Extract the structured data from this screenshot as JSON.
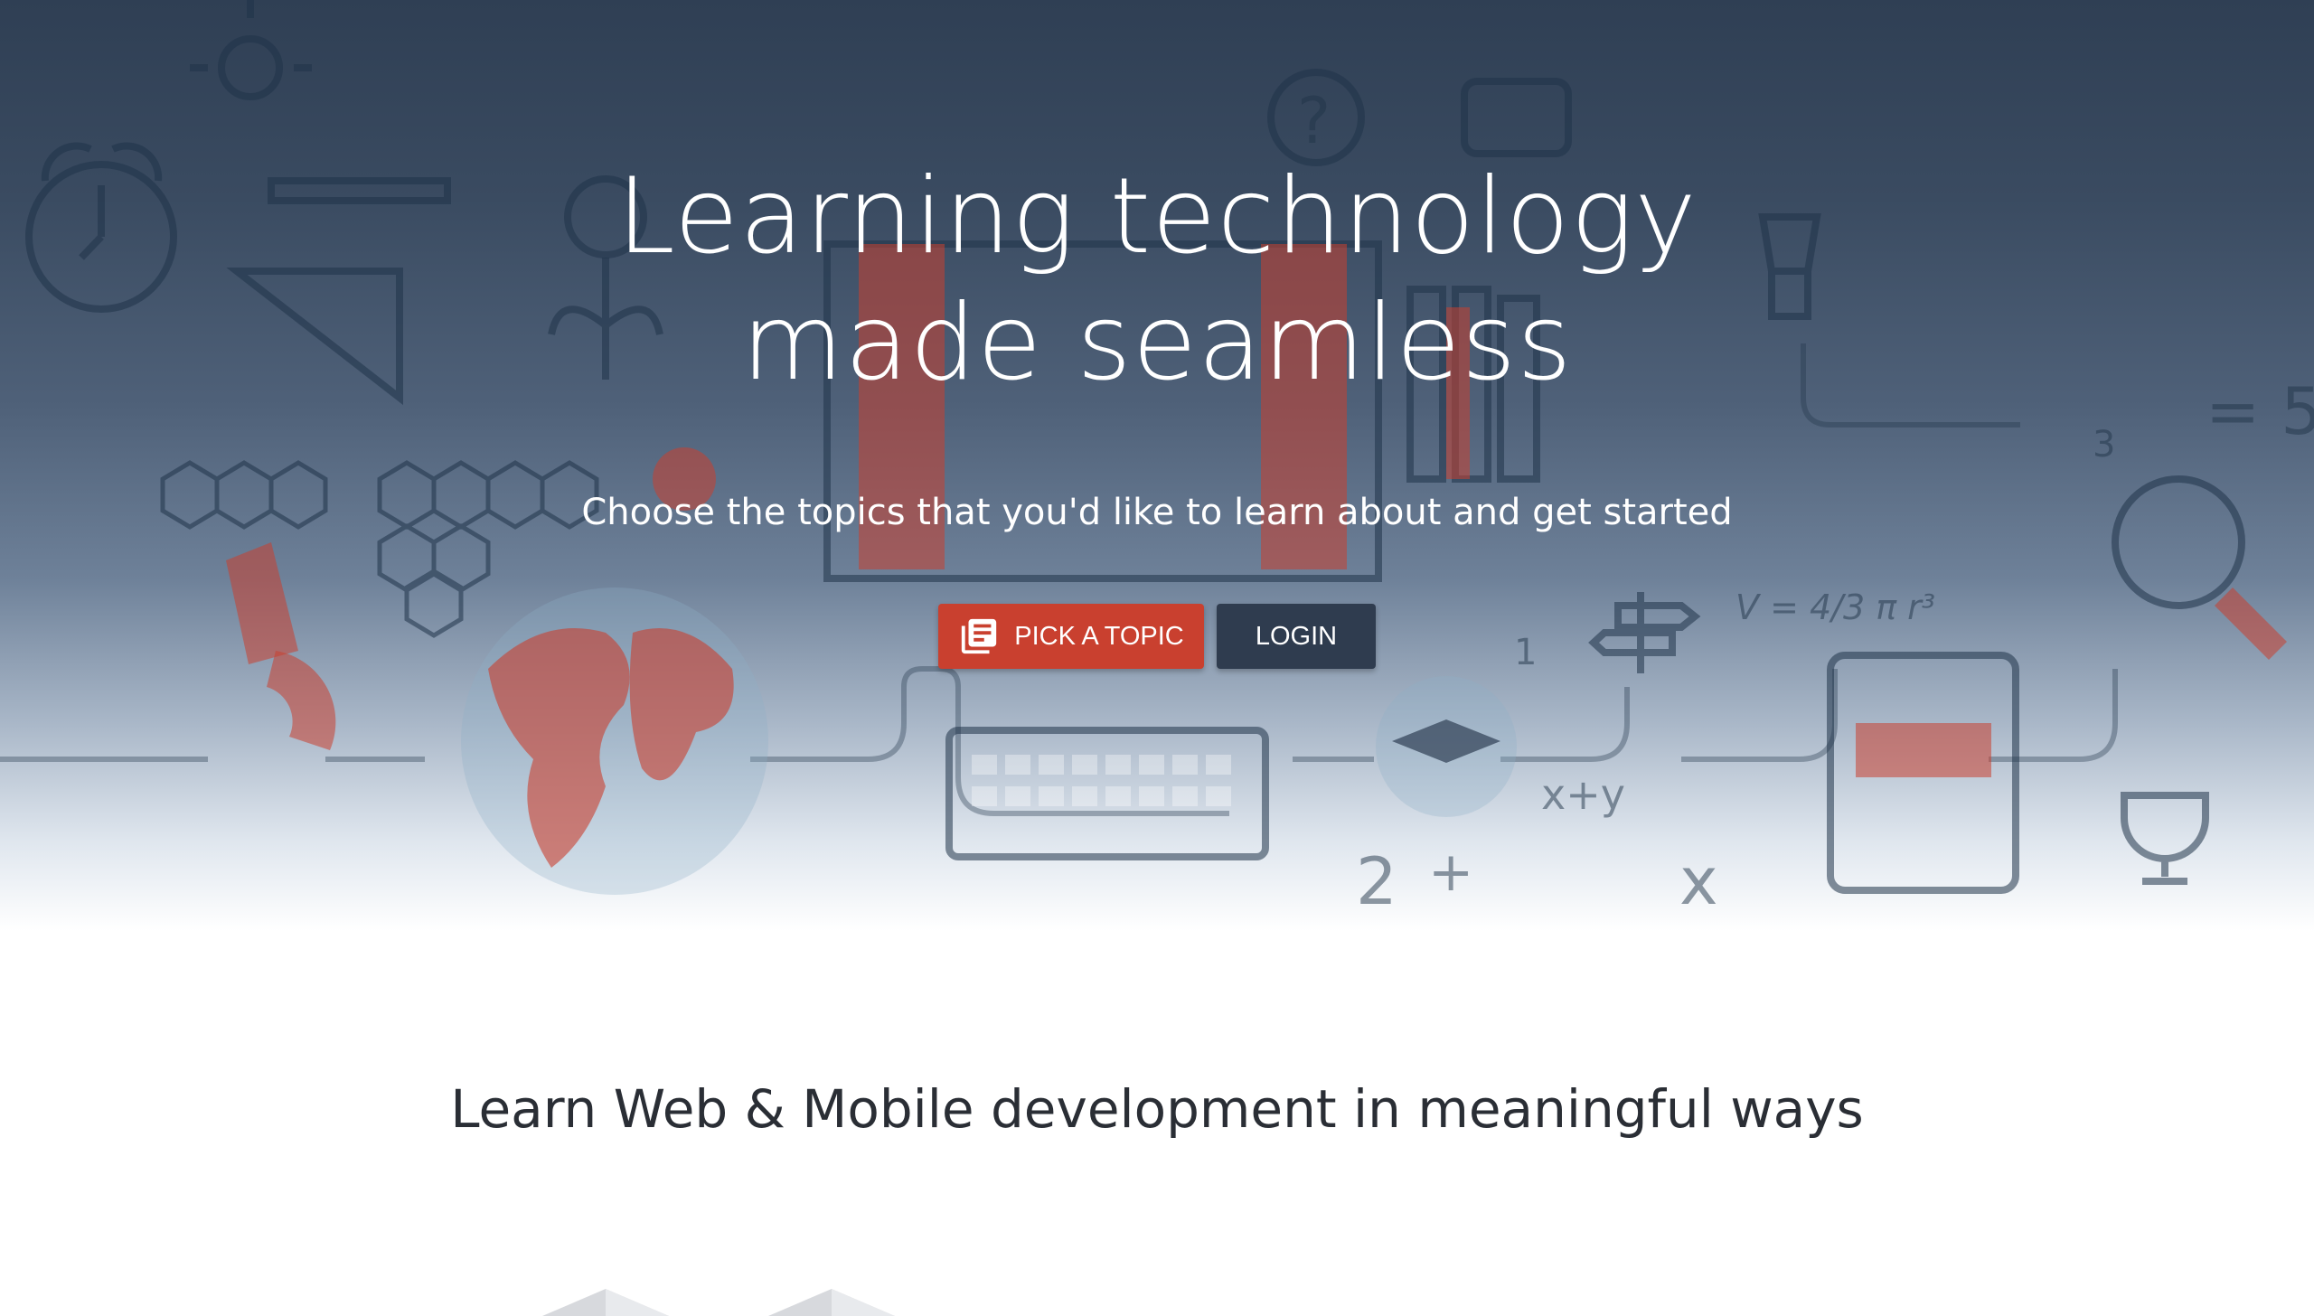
{
  "hero": {
    "title_line1": "Learning technology",
    "title_line2": "made seamless",
    "subtitle": "Choose the topics that you'd like to learn about and get started",
    "buttons": {
      "pick_topic": "PICK A TOPIC",
      "login": "LOGIN"
    },
    "decor_labels": {
      "volume_formula": "V = 4/3 π r³",
      "sum_label": "x+y",
      "num_one": "1",
      "num_two": "2",
      "num_three": "3",
      "x_label": "x",
      "plus": "+",
      "equals_five": "= 5",
      "question": "?"
    }
  },
  "section": {
    "title": "Learn Web & Mobile development in meaningful ways"
  },
  "colors": {
    "hero_top": "#2f3f54",
    "accent_red": "#c9402f",
    "login_dark": "#2f3c4f",
    "text_dark": "#2a2e35"
  },
  "icons": {
    "pick_topic": "library-books-icon"
  }
}
